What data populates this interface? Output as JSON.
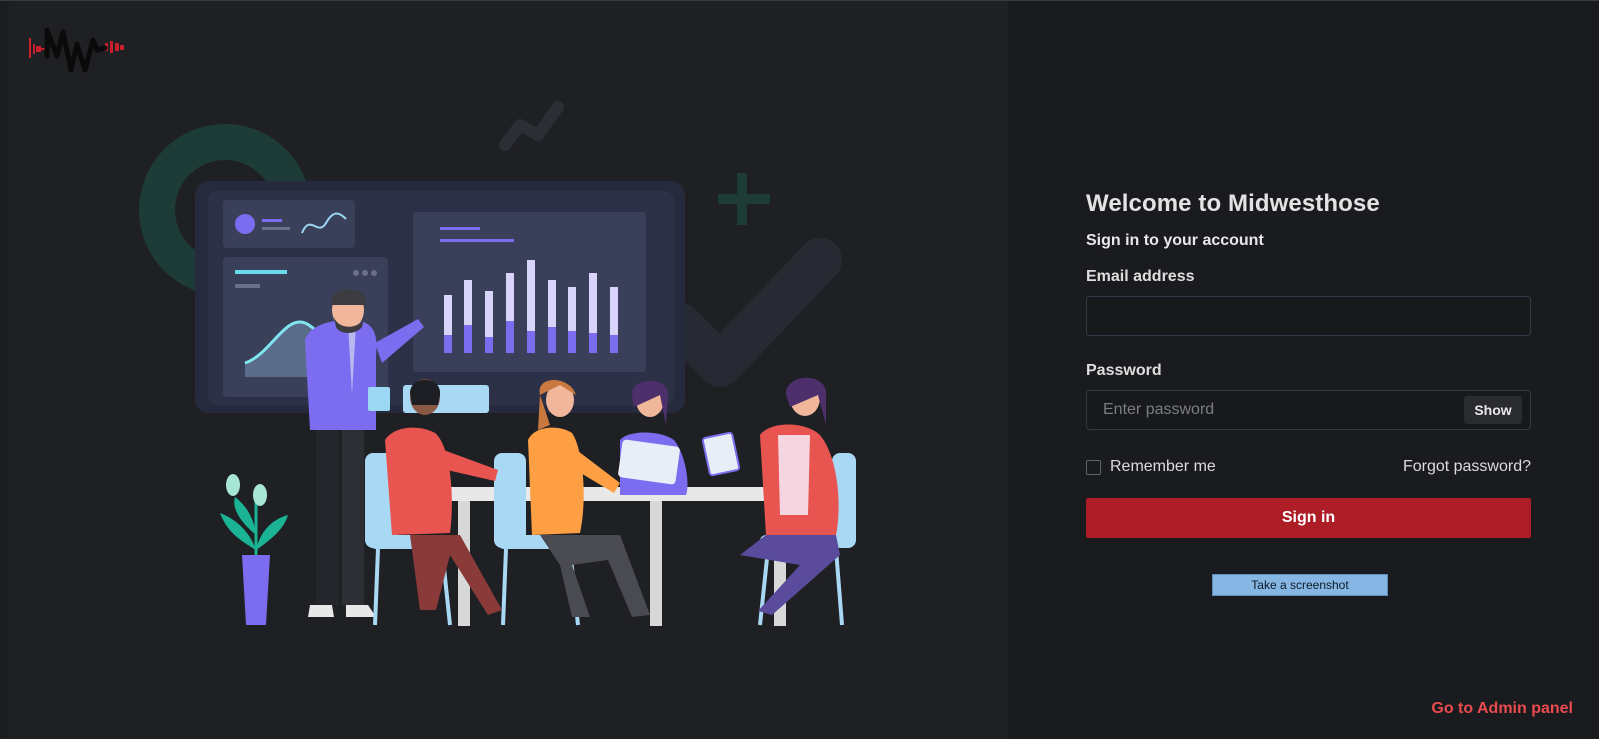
{
  "brand": {
    "logo_icon": "mw-logo-icon",
    "accent_color": "#ad1d26"
  },
  "login": {
    "title": "Welcome to Midwesthose",
    "subtitle": "Sign in to your account",
    "email_label": "Email address",
    "email_value": "",
    "password_label": "Password",
    "password_placeholder": "Enter password",
    "show_label": "Show",
    "remember_label": "Remember me",
    "forgot_label": "Forgot password?",
    "signin_label": "Sign in"
  },
  "tools": {
    "screenshot_label": "Take a screenshot"
  },
  "footer": {
    "admin_link": "Go to Admin panel"
  },
  "colors": {
    "panel_left": "#1f2023",
    "panel_right": "#1a1b1e",
    "link_red": "#e94b4e",
    "button_blue": "#86b6e3"
  }
}
